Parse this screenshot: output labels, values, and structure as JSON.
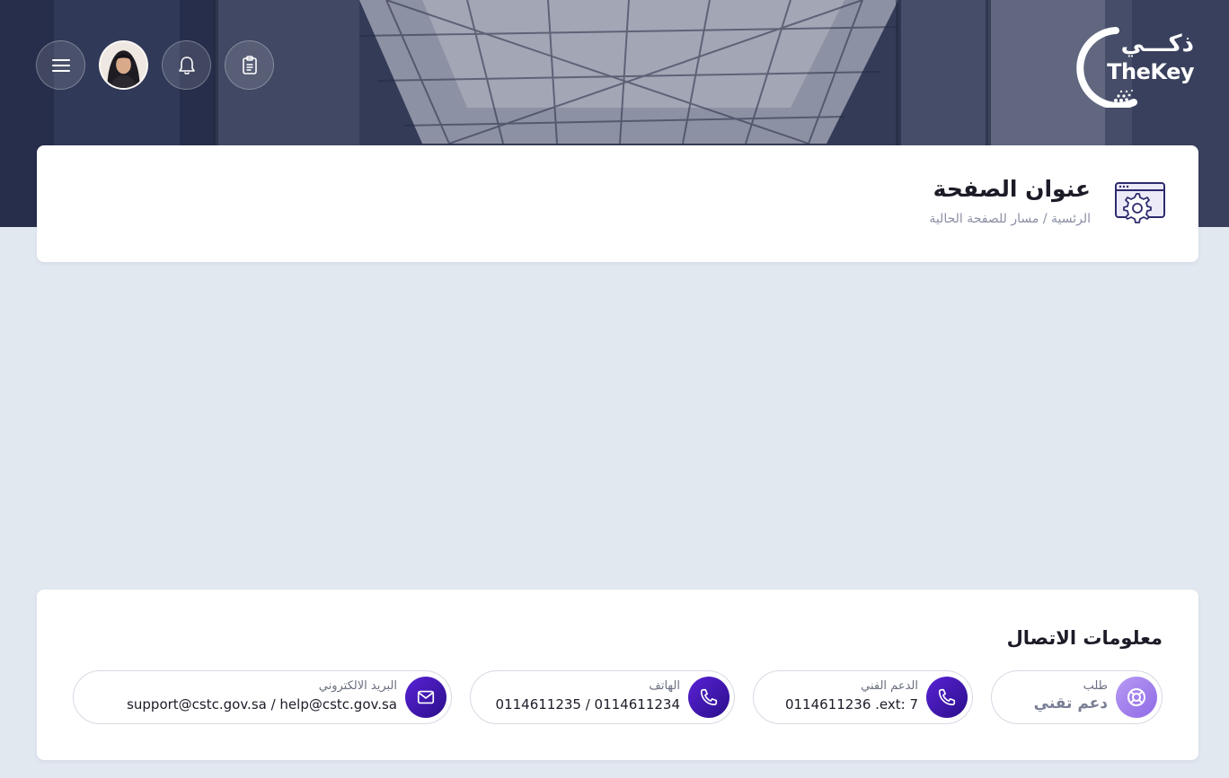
{
  "header": {
    "logo": {
      "arabic": "ذكـــي",
      "english": "TheKey"
    },
    "icons": {
      "menu": "menu-icon",
      "bell": "bell-icon",
      "tasks": "clipboard-icon",
      "avatar": "user-avatar"
    }
  },
  "page": {
    "title": "عنوان الصفحة",
    "breadcrumb": {
      "home": "الرئسية",
      "separator": "/",
      "current": "مسار للصفحة الحالية"
    },
    "icon": "settings-window-icon"
  },
  "contact": {
    "title": "معلومات الاتصال",
    "items": [
      {
        "label": "طلب",
        "value": "دعم تقني",
        "icon": "lifebuoy-icon"
      },
      {
        "label": "الدعم الفني",
        "value": "0114611236 .ext: 7",
        "icon": "phone-icon"
      },
      {
        "label": "الهاتف",
        "value": "0114611235 / 0114611234",
        "icon": "phone-icon"
      },
      {
        "label": "البريد الالكتروني",
        "value": "support@cstc.gov.sa / help@cstc.gov.sa",
        "icon": "mail-icon"
      }
    ]
  },
  "colors": {
    "accent": "#3b14b4",
    "accent_light": "#a484ee",
    "background": "#e2e8f0"
  }
}
